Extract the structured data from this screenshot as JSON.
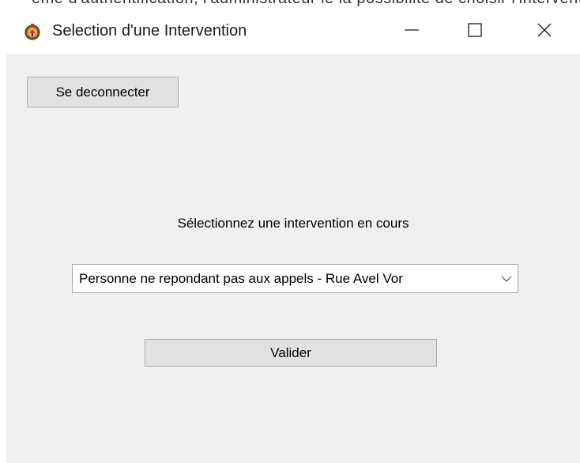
{
  "window": {
    "title": "Selection d'une Intervention",
    "controls": {
      "minimize_icon": "minimize-icon",
      "maximize_icon": "maximize-icon",
      "close_icon": "close-icon"
    }
  },
  "background_text": "eme d'authentification, l'administrateur le la possibilite de choisir l'intervention sur",
  "toolbar": {
    "logout_label": "Se deconnecter"
  },
  "main": {
    "prompt": "Sélectionnez une intervention en cours",
    "intervention_select": {
      "selected_value": "Personne ne repondant pas aux appels - Rue Avel Vor"
    },
    "validate_label": "Valider"
  },
  "colors": {
    "client_background": "#f0f0f0",
    "button_face": "#e1e1e1",
    "button_border": "#adadad"
  }
}
